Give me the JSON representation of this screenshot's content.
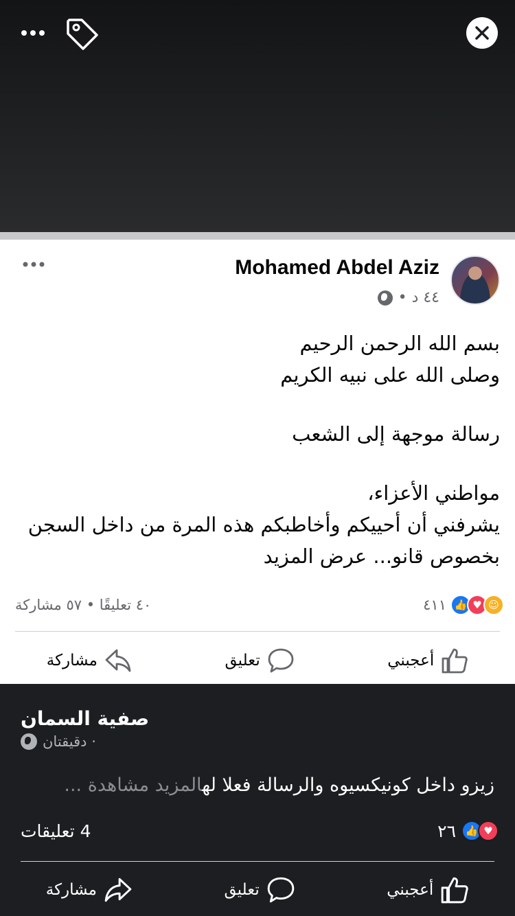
{
  "post": {
    "author": "Mohamed Abdel Aziz",
    "time": "٤٤ د •",
    "lines": [
      "بسم الله الرحمن الرحيم",
      "وصلى الله على نبيه الكريم",
      "",
      "رسالة موجهة إلى الشعب",
      "",
      "مواطني الأعزاء،",
      "يشرفني أن أحييكم وأخاطبكم هذه المرة من داخل السجن",
      "بخصوص قانو... عرض المزيد"
    ],
    "reaction_count": "٤١١",
    "comments_shares": "٤٠ تعليقًا • ٥٧ مشاركة",
    "like_label": "أعجبني",
    "comment_label": "تعليق",
    "share_label": "مشاركة"
  },
  "comment": {
    "name": "صفية السمان",
    "time": "دقيقتان ·",
    "text": "زيزو داخل كونيكسيوه والرسالة فعلا له",
    "see_more": "المزيد مشاهدة ...",
    "reaction_count": "٢٦",
    "comments_count": "4 تعليقات",
    "like_label": "أعجبني",
    "comment_label": "تعليق",
    "share_label": "مشاركة"
  },
  "colors": {
    "like_blue": "#1877f2",
    "love_red": "#f33e58",
    "care_yellow": "#f7b125"
  },
  "icons": [
    "more-icon",
    "tag-icon",
    "close-icon",
    "globe-icon",
    "like-icon",
    "comment-icon",
    "share-icon"
  ]
}
